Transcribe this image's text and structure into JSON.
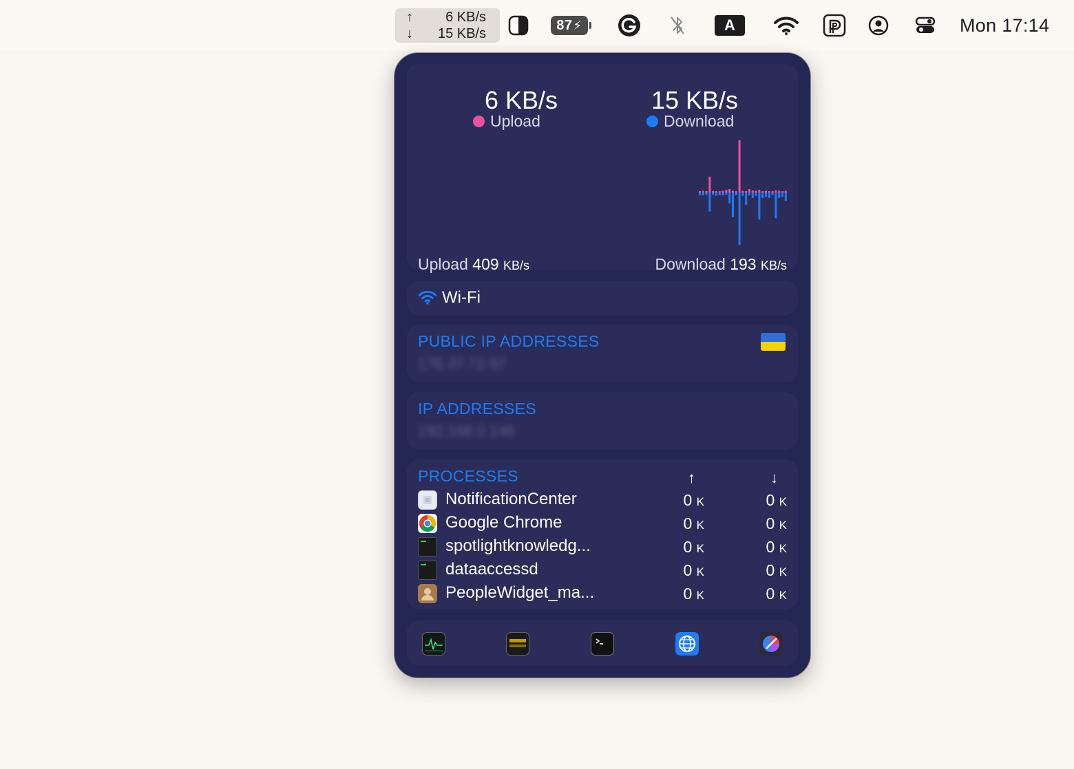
{
  "menubar": {
    "net_up": "6 KB/s",
    "net_down": "15 KB/s",
    "battery_level": "87",
    "input_source": "A",
    "clock": "Mon 17:14",
    "icons": [
      "contrast-icon",
      "battery-charging-icon",
      "grammarly-icon",
      "bluetooth-off-icon",
      "input-source-icon",
      "wifi-icon",
      "pasta-icon",
      "user-icon",
      "control-center-icon"
    ]
  },
  "panel": {
    "upload_value": "6 KB/s",
    "upload_label": "Upload",
    "download_value": "15 KB/s",
    "download_label": "Download",
    "upload_color": "#f0509c",
    "download_color": "#1b7cf5",
    "peak_upload_label": "Upload",
    "peak_upload_value": "409",
    "peak_upload_unit": "KB/s",
    "peak_download_label": "Download",
    "peak_download_value": "193",
    "peak_download_unit": "KB/s",
    "wifi_label": "Wi-Fi",
    "public_ip_title": "PUBLIC IP ADDRESSES",
    "public_ip_value": "176.37.72.97",
    "flag": "Ukraine",
    "ip_title": "IP ADDRESSES",
    "ip_value": "192.168.0.146",
    "processes_title": "PROCESSES",
    "processes": [
      {
        "name": "NotificationCenter",
        "up": "0",
        "down": "0",
        "unit": "K",
        "icon": "notification-center-icon"
      },
      {
        "name": "Google Chrome",
        "up": "0",
        "down": "0",
        "unit": "K",
        "icon": "chrome-icon"
      },
      {
        "name": "spotlightknowledg...",
        "up": "0",
        "down": "0",
        "unit": "K",
        "icon": "terminal-exec-icon"
      },
      {
        "name": "dataaccessd",
        "up": "0",
        "down": "0",
        "unit": "K",
        "icon": "terminal-exec-icon"
      },
      {
        "name": "PeopleWidget_ma...",
        "up": "0",
        "down": "0",
        "unit": "K",
        "icon": "contacts-icon"
      }
    ],
    "dock_apps": [
      "activity-monitor-icon",
      "console-icon",
      "terminal-icon",
      "network-utility-icon",
      "wireless-diagnostics-icon"
    ]
  },
  "chart_data": {
    "type": "bar",
    "title": "",
    "series": [
      {
        "name": "Upload",
        "values": [
          5,
          8,
          5,
          70,
          5,
          6,
          5,
          8,
          12,
          15,
          8,
          6,
          230,
          8,
          5,
          15,
          10,
          8,
          12,
          6,
          8,
          6,
          5,
          10,
          8,
          5,
          8
        ]
      },
      {
        "name": "Download",
        "values": [
          10,
          10,
          8,
          70,
          8,
          12,
          10,
          10,
          8,
          40,
          90,
          10,
          193,
          12,
          45,
          10,
          20,
          12,
          100,
          20,
          15,
          20,
          10,
          95,
          20,
          15,
          30
        ]
      }
    ],
    "ylabel": "",
    "note": ""
  }
}
